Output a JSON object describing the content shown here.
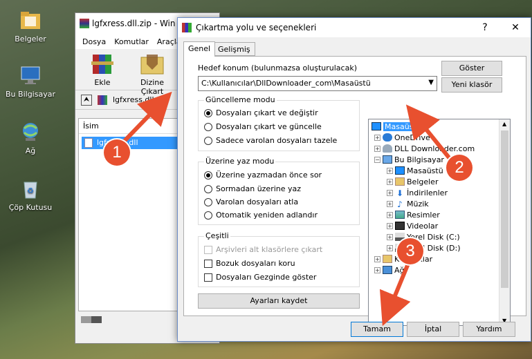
{
  "desktop": {
    "icons": [
      {
        "label": "Belgeler"
      },
      {
        "label": "Bu Bilgisayar"
      },
      {
        "label": "Ağ"
      },
      {
        "label": "Çöp Kutusu"
      }
    ]
  },
  "winrar": {
    "title": "lgfxress.dll.zip - Win",
    "menu": [
      "Dosya",
      "Komutlar",
      "Araçla"
    ],
    "tools": [
      "Ekle",
      "Dizine Çıkart"
    ],
    "address": "lgfxress.dll.",
    "column_header": "İsim",
    "selected_file": "lgfxress.dll"
  },
  "dialog": {
    "title": "Çıkartma yolu ve seçenekleri",
    "tabs": [
      "Genel",
      "Gelişmiş"
    ],
    "dest_label": "Hedef konum (bulunmazsa oluşturulacak)",
    "dest_path": "C:\\Kullanıcılar\\DllDownloader_com\\Masaüstü",
    "show_button": "Göster",
    "new_folder_button": "Yeni klasör",
    "update_group": {
      "title": "Güncelleme modu",
      "options": [
        "Dosyaları çıkart ve değiştir",
        "Dosyaları çıkart ve güncelle",
        "Sadece varolan dosyaları tazele"
      ]
    },
    "overwrite_group": {
      "title": "Üzerine yaz modu",
      "options": [
        "Üzerine yazmadan önce sor",
        "Sormadan üzerine yaz",
        "Varolan dosyaları atla",
        "Otomatik yeniden adlandır"
      ]
    },
    "misc_group": {
      "title": "Çeşitli",
      "options": [
        "Arşivleri alt klasörlere çıkart",
        "Bozuk dosyaları koru",
        "Dosyaları Gezginde göster"
      ]
    },
    "save_settings_button": "Ayarları kaydet",
    "tree": [
      {
        "label": "Masaüstü",
        "selected": true
      },
      {
        "label": "OneDrive"
      },
      {
        "label": "DLL Downloader.com"
      },
      {
        "label": "Bu Bilgisayar"
      },
      {
        "label": "Masaüstü"
      },
      {
        "label": "Belgeler"
      },
      {
        "label": "İndirilenler"
      },
      {
        "label": "Müzik"
      },
      {
        "label": "Resimler"
      },
      {
        "label": "Videolar"
      },
      {
        "label": "Yerel Disk (C:)"
      },
      {
        "label": "Yerel Disk (D:)"
      },
      {
        "label": "Kitaplıklar"
      },
      {
        "label": "Ağ"
      }
    ],
    "ok_button": "Tamam",
    "cancel_button": "İptal",
    "help_button": "Yardım"
  },
  "annotations": [
    "1",
    "2",
    "3"
  ],
  "colors": {
    "accent": "#3399ff",
    "badge": "#e8502f",
    "arrow": "#e8502f"
  }
}
